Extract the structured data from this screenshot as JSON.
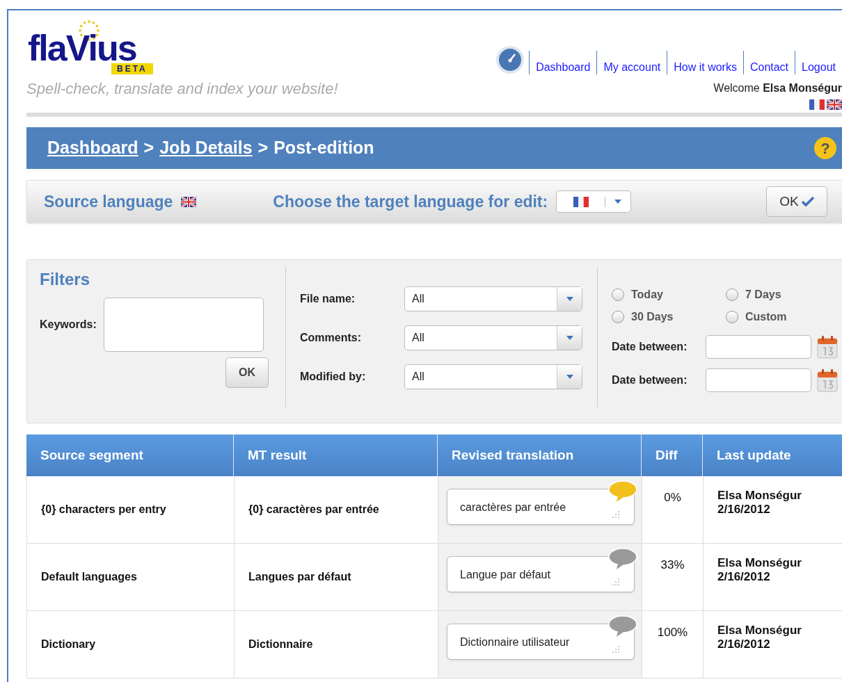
{
  "logo": {
    "name": "flaVius",
    "badge": "BETA",
    "tagline": "Spell-check, translate and index your website!"
  },
  "nav": {
    "links": [
      "Dashboard",
      "My account",
      "How it works",
      "Contact",
      "Logout"
    ],
    "welcome": "Welcome ",
    "user": "Elsa Monségur"
  },
  "breadcrumb": {
    "links": [
      "Dashboard",
      "Job Details"
    ],
    "separators": [
      ">",
      ">"
    ],
    "current": "Post-edition",
    "help": "?"
  },
  "language_bar": {
    "source_label": "Source language",
    "target_label": "Choose the target language for edit:",
    "ok": "OK"
  },
  "filters": {
    "title": "Filters",
    "keywords_label": "Keywords:",
    "ok": "OK",
    "selects": [
      {
        "label": "File name:",
        "value": "All"
      },
      {
        "label": "Comments:",
        "value": "All"
      },
      {
        "label": "Modified by:",
        "value": "All"
      }
    ],
    "periods": [
      {
        "label": "Today",
        "selected": false
      },
      {
        "label": "7 Days",
        "selected": false
      },
      {
        "label": "30 Days",
        "selected": false
      },
      {
        "label": "Custom",
        "selected": false
      }
    ],
    "date_labels": [
      "Date between:",
      "Date between:"
    ]
  },
  "table": {
    "columns": [
      "Source segment",
      "MT result",
      "Revised translation",
      "Diff",
      "Last update"
    ],
    "rows": [
      {
        "source": "{0} characters per entry",
        "mt": "{0} caractères par entrée",
        "revised": "caractères par entrée",
        "comment_highlighted": true,
        "diff": "0%",
        "user": "Elsa Monségur",
        "date": "2/16/2012"
      },
      {
        "source": "Default languages",
        "mt": "Langues par défaut",
        "revised": "Langue par défaut",
        "comment_highlighted": false,
        "diff": "33%",
        "user": "Elsa Monségur",
        "date": "2/16/2012"
      },
      {
        "source": "Dictionary",
        "mt": "Dictionnaire",
        "revised": "Dictionnaire utilisateur",
        "comment_highlighted": false,
        "diff": "100%",
        "user": "Elsa Monségur",
        "date": "2/16/2012"
      }
    ]
  }
}
